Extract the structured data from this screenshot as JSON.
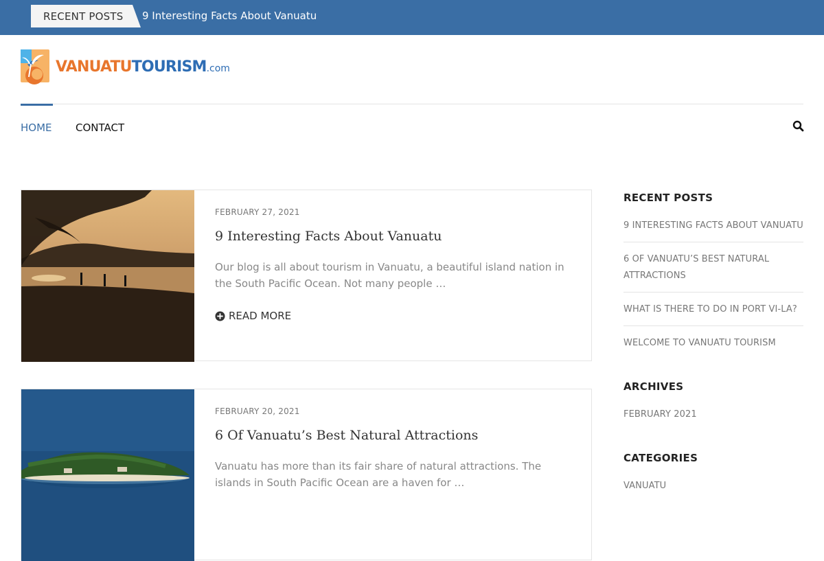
{
  "topbar": {
    "recent_label": "RECENT POSTS",
    "ticker_text": "9 Interesting Facts About Vanuatu"
  },
  "logo": {
    "part1": "VANUATU",
    "part2": "TOURISM",
    "part3": ".com"
  },
  "nav": {
    "home": "HOME",
    "contact": "CONTACT",
    "search_icon": "search-icon"
  },
  "posts": [
    {
      "date": "FEBRUARY 27, 2021",
      "title": "9 Interesting Facts About Vanuatu",
      "excerpt": "Our blog is all about tourism in Vanuatu, a beautiful island nation in the South Pacific Ocean. Not many people …",
      "read_more": "READ MORE"
    },
    {
      "date": "FEBRUARY 20, 2021",
      "title": "6 Of Vanuatu’s Best Natural Attractions",
      "excerpt": "Vanuatu has more than its fair share of natural attractions. The islands in South Pacific Ocean are a haven for …"
    }
  ],
  "sidebar": {
    "recent_title": "RECENT POSTS",
    "recent_items": [
      "9 INTERESTING FACTS ABOUT VANUATU",
      "6 OF VANUATU’S BEST NATURAL ATTRACTIONS",
      "WHAT IS THERE TO DO IN PORT VI-LA?",
      "WELCOME TO VANUATU TOURISM"
    ],
    "archives_title": "ARCHIVES",
    "archives_items": [
      "FEBRUARY 2021"
    ],
    "categories_title": "CATEGORIES",
    "categories_items": [
      "VANUATU"
    ]
  },
  "colors": {
    "brand_blue": "#3a6ea5",
    "logo_orange": "#e8762d"
  }
}
